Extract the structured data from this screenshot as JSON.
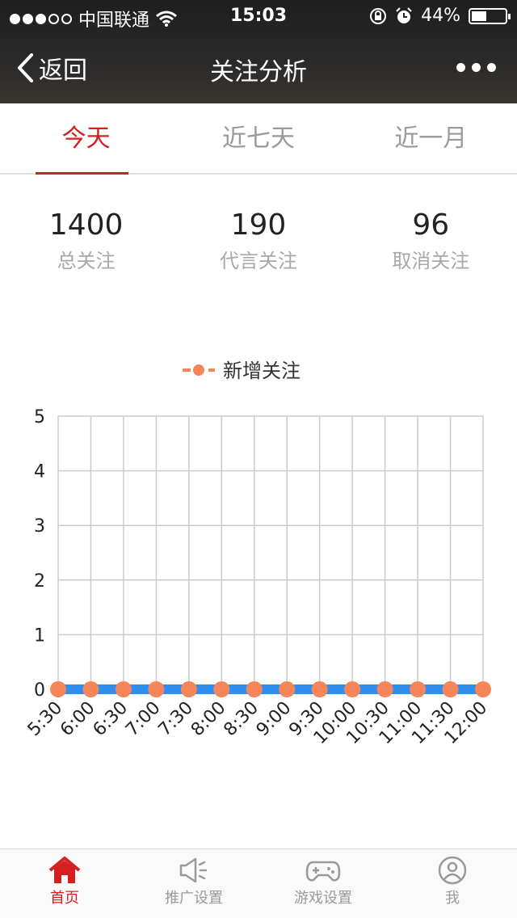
{
  "status_bar": {
    "carrier": "中国联通",
    "time": "15:03",
    "battery": "44%",
    "battery_level": 0.44
  },
  "nav": {
    "back_label": "返回",
    "title": "关注分析"
  },
  "tabs": [
    {
      "label": "今天",
      "active": true
    },
    {
      "label": "近七天",
      "active": false
    },
    {
      "label": "近一月",
      "active": false
    }
  ],
  "stats": [
    {
      "value": "1400",
      "label": "总关注"
    },
    {
      "value": "190",
      "label": "代言关注"
    },
    {
      "value": "96",
      "label": "取消关注"
    }
  ],
  "chart_data": {
    "type": "line",
    "x": [
      "5:30",
      "6:00",
      "6:30",
      "7:00",
      "7:30",
      "8:00",
      "8:30",
      "9:00",
      "9:30",
      "10:00",
      "10:30",
      "11:00",
      "11:30",
      "12:00"
    ],
    "series": [
      {
        "name": "新增关注",
        "values": [
          0,
          0,
          0,
          0,
          0,
          0,
          0,
          0,
          0,
          0,
          0,
          0,
          0,
          0
        ]
      }
    ],
    "ylim": [
      0,
      5
    ],
    "yticks": [
      0,
      1,
      2,
      3,
      4,
      5
    ],
    "grid": true,
    "legend": "top-center",
    "colors": {
      "line": "#2f8ff0",
      "marker": "#f7855a",
      "grid": "#cccccc"
    }
  },
  "tabbar": [
    {
      "label": "首页",
      "icon": "home-icon",
      "active": true
    },
    {
      "label": "推广设置",
      "icon": "megaphone-icon",
      "active": false
    },
    {
      "label": "游戏设置",
      "icon": "gamepad-icon",
      "active": false
    },
    {
      "label": "我",
      "icon": "user-icon",
      "active": false
    }
  ],
  "colors": {
    "accent": "#d42020",
    "muted": "#9a9a9a"
  }
}
